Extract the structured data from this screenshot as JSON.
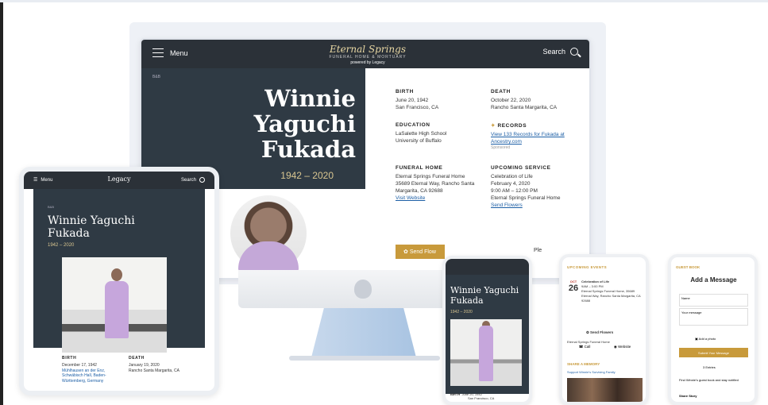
{
  "desktop": {
    "nav": {
      "menu_label": "Menu",
      "brand": "Eternal Springs",
      "brand_sub": "FUNERAL HOME & MORTUARY",
      "brand_powered": "powered by Legacy",
      "search_label": "Search"
    },
    "breadcrumb": "B&B",
    "name_lines": [
      "Winnie",
      "Yaguchi",
      "Fukada"
    ],
    "years": "1942 – 2020",
    "birth": {
      "label": "BIRTH",
      "date": "June 20, 1942",
      "place": "San Francisco, CA"
    },
    "death": {
      "label": "DEATH",
      "date": "October 22, 2020",
      "place": "Rancho Santa Margarita, CA"
    },
    "education": {
      "label": "EDUCATION",
      "school1": "LaSalette High School",
      "school2": "University of Buffalo"
    },
    "records": {
      "label": "RECORDS",
      "link": "View 133 Records for Fukada at Ancestry.com",
      "sponsored": "Sponsored"
    },
    "funeral_home": {
      "label": "FUNERAL HOME",
      "name": "Eternal Springs Funeral Home",
      "address": "35689 Eternal Way, Rancho Santa Margarita, CA 92688",
      "link": "Visit Website"
    },
    "service": {
      "label": "UPCOMING SERVICE",
      "title": "Celebration of Life",
      "date": "February 4, 2020",
      "time": "9:00 AM – 12:00 PM",
      "venue": "Eternal Springs Funeral Home",
      "link": "Send Flowers"
    },
    "button": "Send Flow",
    "fragment": "Ple"
  },
  "tablet": {
    "nav": {
      "menu_label": "Menu",
      "brand": "Legacy",
      "search_label": "Search"
    },
    "breadcrumb": "B&B",
    "name": "Winnie Yaguchi Fukada",
    "years": "1942 – 2020",
    "birth": {
      "label": "BIRTH",
      "date": "December 17, 1942",
      "place": "Mühlhausen an der Enz, Schwäbisch Hall, Baden-Württemberg, Germany"
    },
    "death": {
      "label": "DEATH",
      "date": "January 19, 2020",
      "place": "Rancho Santa Margarita, CA"
    }
  },
  "phone1": {
    "name": "Winnie Yaguchi Fukada",
    "years": "1942 – 2020",
    "birth_label": "BIRTH",
    "birth_date": "June 20, 1942",
    "birth_place": "San Francisco, CA"
  },
  "phone2": {
    "heading": "UPCOMING EVENTS",
    "month": "OCT",
    "day": "26",
    "event_title": "Celebration of Life",
    "event_time": "9AM – 3:00 PM",
    "event_place": "Eternal Springs Funeral Home, 35689 Eternal Way, Rancho Santa Margarita, CA 92688",
    "flowers": "Send Flowers",
    "funeral_home": "Eternal Springs Funeral Home",
    "call": "Call",
    "website": "Website",
    "share_heading": "SHARE A MEMORY",
    "share_link": "Support Winnie's Surviving Family"
  },
  "phone3": {
    "heading": "GUEST BOOK",
    "title": "Add a Message",
    "name_label": "Name",
    "message_label": "Your message",
    "add_photo": "Add a photo",
    "button": "Submit Your Message",
    "entries": "3 Entries",
    "subscribe": "Find Winnie's guest book and stay notified",
    "share": "Share Story"
  }
}
